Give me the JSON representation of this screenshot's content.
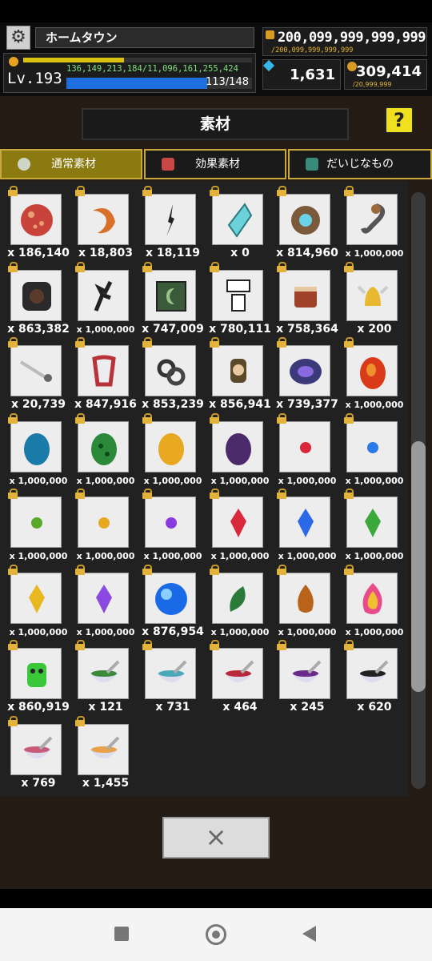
{
  "hud": {
    "location": "ホームタウン",
    "level": "Lv.193",
    "exp_text": "136,149,213,184/11,096,161,255,424",
    "exp_fraction": 0.44,
    "hp_text": "113/148",
    "hp_fraction": 0.76,
    "gold": "200,099,999,999,999",
    "gold_cap": "/200,099,999,999,999",
    "gems": "1,631",
    "coins": "309,414",
    "coins_cap": "/20,999,999"
  },
  "screen": {
    "title": "素材",
    "help_label": "?",
    "close_label": "×"
  },
  "tabs": [
    {
      "label": "通常素材",
      "active": true,
      "icon": "mortar-icon"
    },
    {
      "label": "効果素材",
      "active": false,
      "icon": "bottle-icon"
    },
    {
      "label": "だいじなもの",
      "active": false,
      "icon": "box-icon"
    }
  ],
  "items": [
    {
      "count": "x 186,140",
      "icon": "red-orb"
    },
    {
      "count": "x 18,803",
      "icon": "flame-crescent"
    },
    {
      "count": "x 18,119",
      "icon": "black-feather"
    },
    {
      "count": "x 0",
      "icon": "cyan-crystal"
    },
    {
      "count": "x 814,960",
      "icon": "gear-eye"
    },
    {
      "count": "x 1,000,000",
      "icon": "hook"
    },
    {
      "count": "x 863,382",
      "icon": "dark-stone"
    },
    {
      "count": "x 1,000,000",
      "icon": "black-branch"
    },
    {
      "count": "x 747,009",
      "icon": "moon-tile"
    },
    {
      "count": "x 780,111",
      "icon": "flower-pot"
    },
    {
      "count": "x 758,364",
      "icon": "drum"
    },
    {
      "count": "x 200",
      "icon": "golden-bell"
    },
    {
      "count": "x 20,739",
      "icon": "silver-spike"
    },
    {
      "count": "x 847,916",
      "icon": "red-harp"
    },
    {
      "count": "x 853,239",
      "icon": "iron-knot"
    },
    {
      "count": "x 856,941",
      "icon": "skull-lantern"
    },
    {
      "count": "x 739,377",
      "icon": "purple-vortex"
    },
    {
      "count": "x 1,000,000",
      "icon": "red-egg"
    },
    {
      "count": "x 1,000,000",
      "icon": "blue-egg"
    },
    {
      "count": "x 1,000,000",
      "icon": "green-egg"
    },
    {
      "count": "x 1,000,000",
      "icon": "gold-egg"
    },
    {
      "count": "x 1,000,000",
      "icon": "purple-egg"
    },
    {
      "count": "x 1,000,000",
      "icon": "red-bead"
    },
    {
      "count": "x 1,000,000",
      "icon": "blue-bead"
    },
    {
      "count": "x 1,000,000",
      "icon": "green-bead"
    },
    {
      "count": "x 1,000,000",
      "icon": "gold-bead"
    },
    {
      "count": "x 1,000,000",
      "icon": "purple-bead"
    },
    {
      "count": "x 1,000,000",
      "icon": "red-shard"
    },
    {
      "count": "x 1,000,000",
      "icon": "blue-shard"
    },
    {
      "count": "x 1,000,000",
      "icon": "green-shard"
    },
    {
      "count": "x 1,000,000",
      "icon": "gold-shard"
    },
    {
      "count": "x 1,000,000",
      "icon": "purple-shard"
    },
    {
      "count": "x 876,954",
      "icon": "blue-orb"
    },
    {
      "count": "x 1,000,000",
      "icon": "green-leaf"
    },
    {
      "count": "x 1,000,000",
      "icon": "amber-flame"
    },
    {
      "count": "x 1,000,000",
      "icon": "rainbow-flame"
    },
    {
      "count": "x 860,919",
      "icon": "green-creature"
    },
    {
      "count": "x 121",
      "icon": "mortar-green"
    },
    {
      "count": "x 731",
      "icon": "mortar-teal"
    },
    {
      "count": "x 464",
      "icon": "mortar-red"
    },
    {
      "count": "x 245",
      "icon": "mortar-purple"
    },
    {
      "count": "x 620",
      "icon": "mortar-black"
    },
    {
      "count": "x 769",
      "icon": "mortar-pink"
    },
    {
      "count": "x 1,455",
      "icon": "mortar-orange"
    }
  ],
  "scroll": {
    "position": 0.72,
    "visible_fraction": 0.42
  }
}
